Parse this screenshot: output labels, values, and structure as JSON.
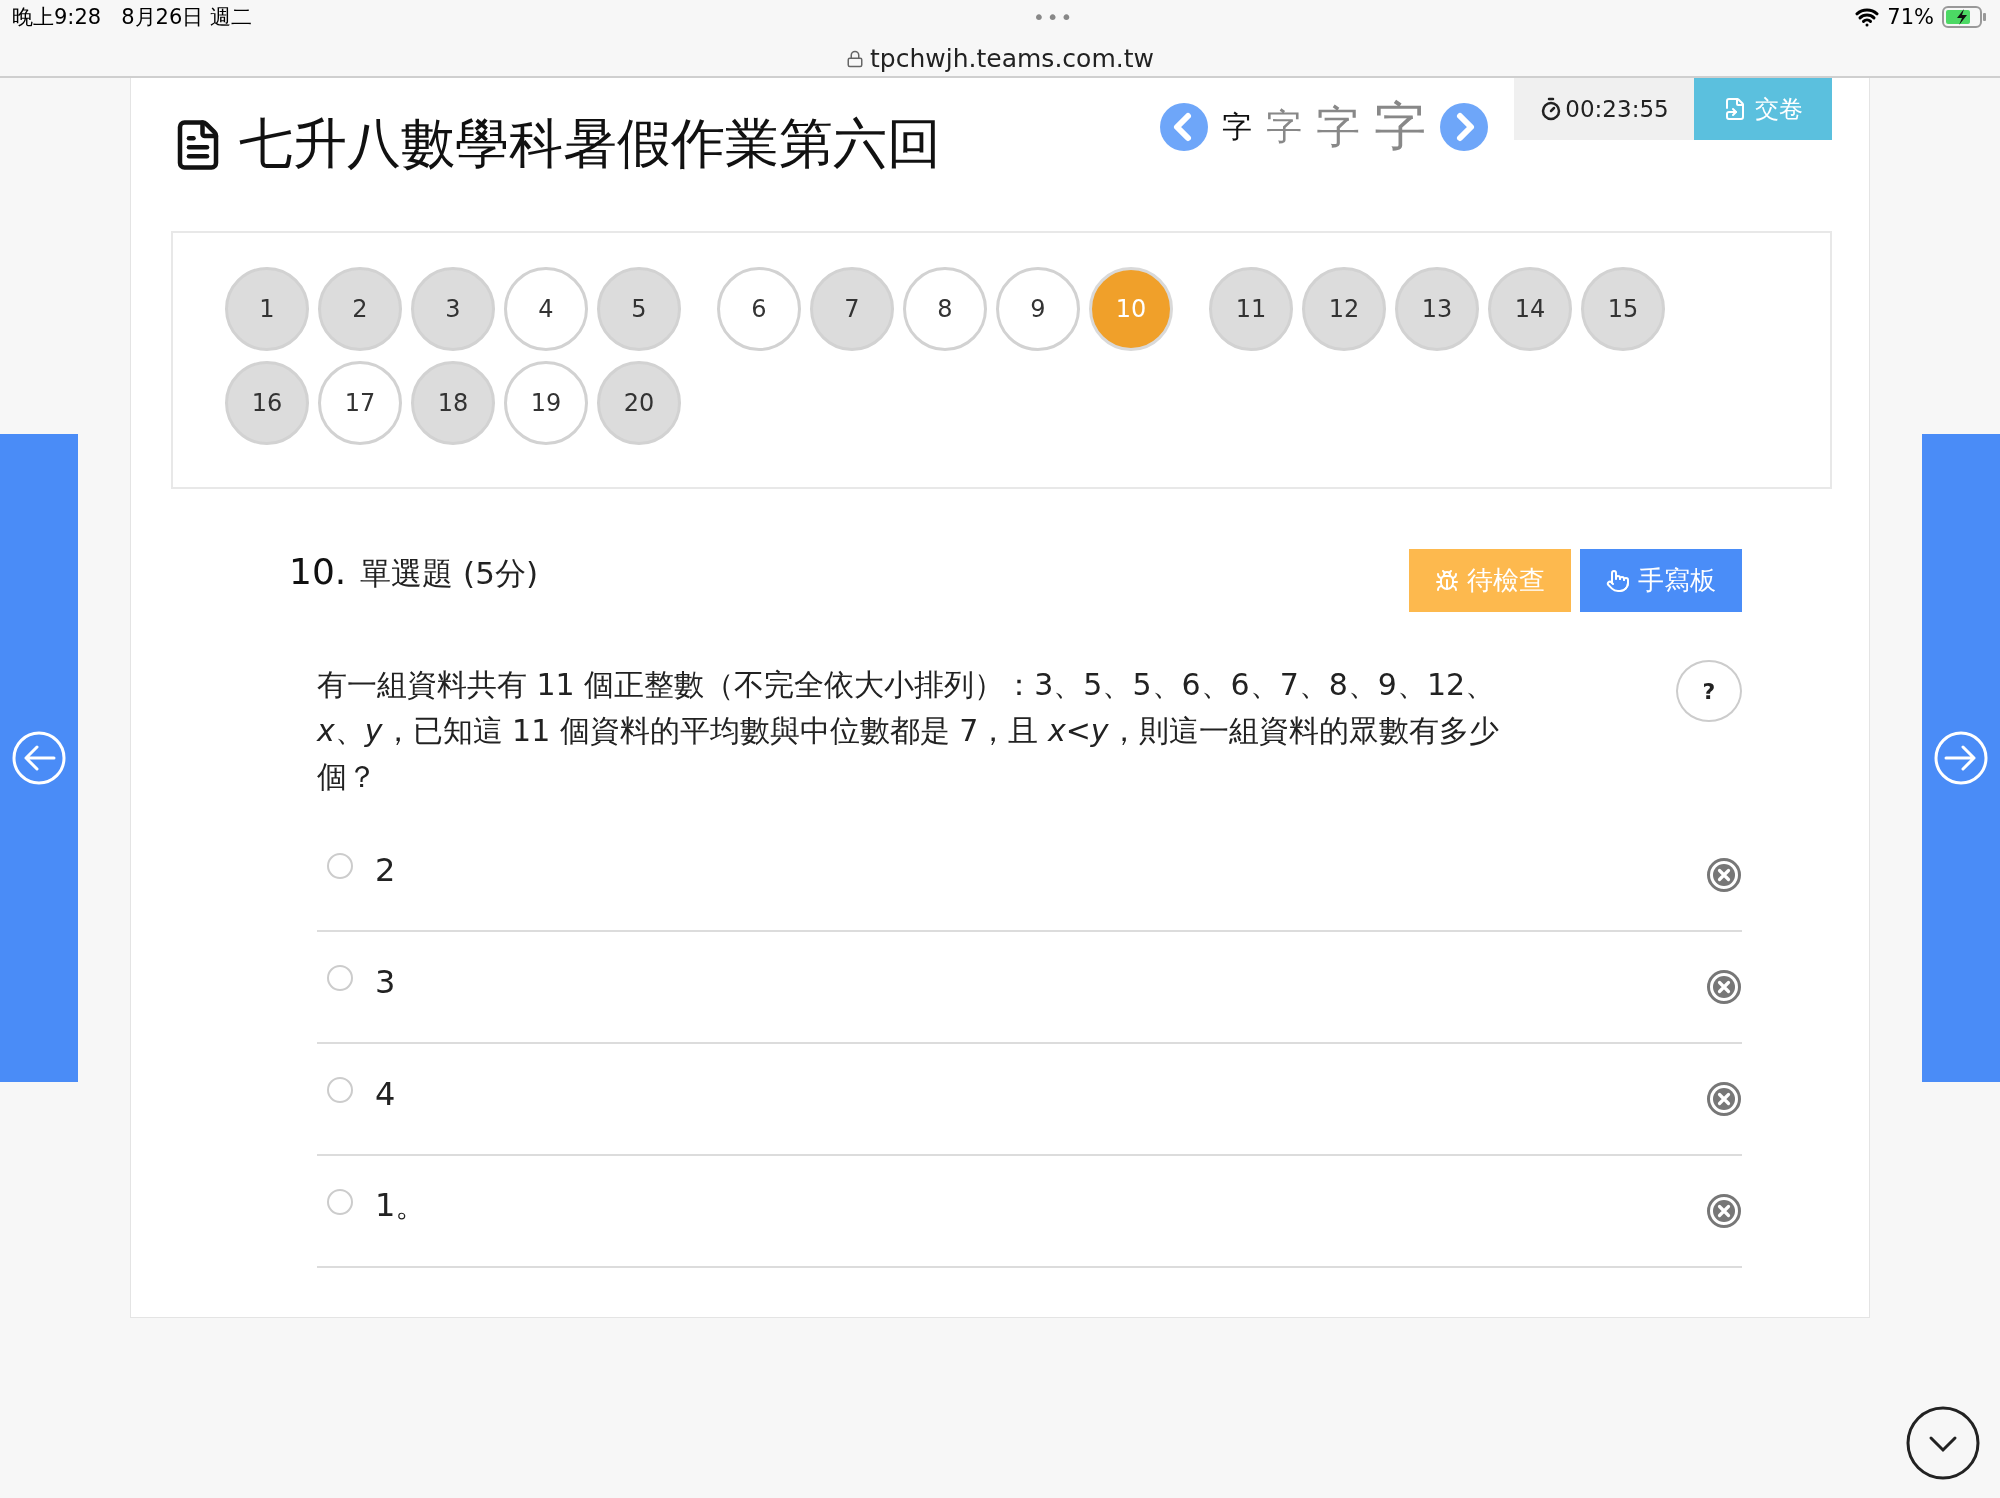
{
  "status_bar": {
    "time": "晚上9:28",
    "date": "8月26日 週二",
    "dots": "•••",
    "battery": "71%",
    "url": "tpchwjh.teams.com.tw"
  },
  "header": {
    "title": "七升八數學科暑假作業第六回",
    "font_sizes": [
      {
        "label": "字",
        "selected": true
      },
      {
        "label": "字",
        "selected": false
      },
      {
        "label": "字",
        "selected": false
      },
      {
        "label": "字",
        "selected": false
      }
    ],
    "timer": "00:23:55",
    "submit": "交卷"
  },
  "questions": [
    {
      "label": "1",
      "answered": true,
      "selected": false
    },
    {
      "label": "2",
      "answered": true,
      "selected": false
    },
    {
      "label": "3",
      "answered": true,
      "selected": false
    },
    {
      "label": "4",
      "answered": false,
      "selected": false
    },
    {
      "label": "5",
      "answered": true,
      "selected": false
    },
    {
      "label": "6",
      "answered": false,
      "selected": false
    },
    {
      "label": "7",
      "answered": true,
      "selected": false
    },
    {
      "label": "8",
      "answered": false,
      "selected": false
    },
    {
      "label": "9",
      "answered": false,
      "selected": false
    },
    {
      "label": "10",
      "answered": false,
      "selected": true
    },
    {
      "label": "11",
      "answered": true,
      "selected": false
    },
    {
      "label": "12",
      "answered": true,
      "selected": false
    },
    {
      "label": "13",
      "answered": true,
      "selected": false
    },
    {
      "label": "14",
      "answered": true,
      "selected": false
    },
    {
      "label": "15",
      "answered": true,
      "selected": false
    },
    {
      "label": "16",
      "answered": true,
      "selected": false
    },
    {
      "label": "17",
      "answered": false,
      "selected": false
    },
    {
      "label": "18",
      "answered": true,
      "selected": false
    },
    {
      "label": "19",
      "answered": false,
      "selected": false
    },
    {
      "label": "20",
      "answered": true,
      "selected": false
    }
  ],
  "question": {
    "number": "10.",
    "type": "單選題 (5分)",
    "review_button": "待檢查",
    "handwriting_button": "手寫板",
    "help": "?",
    "text": "有一組資料共有 11 個正整數（不完全依大小排列）：3、5、5、6、6、7、8、9、12、*x*、*y*，已知這 11 個資料的平均數與中位數都是 7，且 *x*<*y*，則這一組資料的眾數有多少個？",
    "options": [
      {
        "label": "2",
        "selected": false
      },
      {
        "label": "3",
        "selected": false
      },
      {
        "label": "4",
        "selected": false
      },
      {
        "label": "1。",
        "selected": false
      }
    ]
  }
}
